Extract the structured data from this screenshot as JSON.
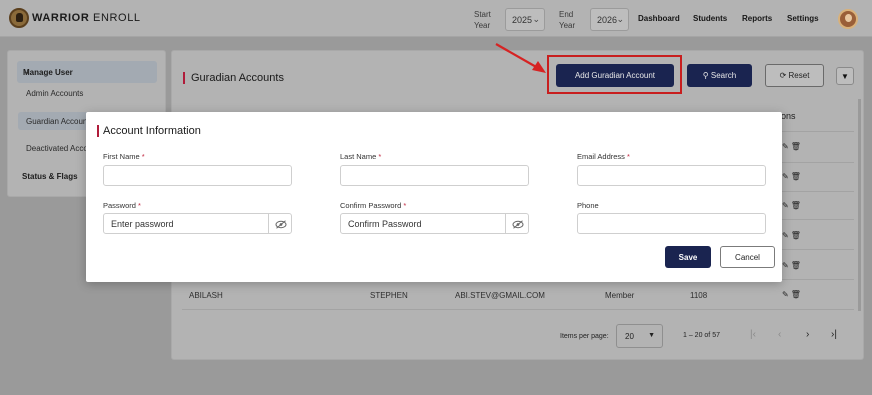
{
  "app": {
    "brand_bold": "WARRIOR",
    "brand_light": " ENROLL"
  },
  "topbar": {
    "start_year_label_1": "Start",
    "start_year_label_2": "Year",
    "start_year_value": "2025",
    "end_year_label_1": "End",
    "end_year_label_2": "Year",
    "end_year_value": "2026",
    "nav": [
      "Dashboard",
      "Students",
      "Reports",
      "Settings"
    ]
  },
  "sidebar": {
    "group_label": "Manage User",
    "items": [
      "Admin Accounts",
      "Guardian Accounts",
      "Deactivated Accounts"
    ],
    "section_label": "Status & Flags"
  },
  "main": {
    "title": "Guradian Accounts",
    "add_button": "Add Guradian Account",
    "search_button": "Search",
    "reset_button": "Reset",
    "actions_header": "ctions",
    "last_row": {
      "first_name": "ABILASH",
      "last_name": "STEPHEN",
      "email": "ABI.STEV@GMAIL.COM",
      "role": "Member",
      "id": "1108"
    },
    "pager": {
      "items_label": "Items per page:",
      "page_size": "20",
      "range": "1 – 20 of 57"
    }
  },
  "modal": {
    "title": "Account Information",
    "fields": {
      "first_name_label": "First Name",
      "last_name_label": "Last Name",
      "email_label": "Email Address",
      "password_label": "Password",
      "password_placeholder": "Enter password",
      "confirm_label": "Confirm Password",
      "confirm_placeholder": "Confirm Password",
      "phone_label": "Phone",
      "required_mark": "*"
    },
    "save_button": "Save",
    "cancel_button": "Cancel"
  },
  "colors": {
    "primary": "#1a2450",
    "accent": "#b01c3a",
    "highlight": "#c81e1e"
  }
}
